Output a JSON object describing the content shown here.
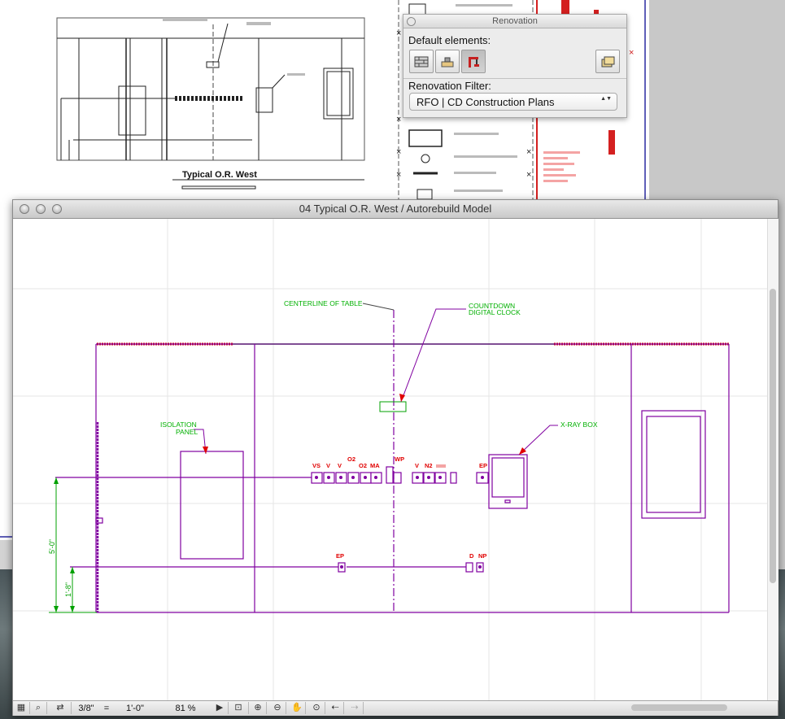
{
  "background_sheet": {
    "view_title": "Typical O.R. West"
  },
  "renovation_palette": {
    "title": "Renovation",
    "default_elements_label": "Default elements:",
    "filter_label": "Renovation Filter:",
    "filter_value": "RFO | CD Construction Plans",
    "element_buttons": [
      {
        "icon": "existing-wall-icon",
        "state": "off"
      },
      {
        "icon": "demolish-icon",
        "state": "off"
      },
      {
        "icon": "new-construction-icon",
        "state": "on"
      }
    ],
    "settings_icon": "renovation-settings-icon"
  },
  "window": {
    "title": "04 Typical O.R. West / Autorebuild Model"
  },
  "drawing": {
    "annotations": {
      "centerline": "CENTERLINE OF TABLE",
      "clock_line1": "COUNTDOWN",
      "clock_line2": "DIGITAL CLOCK",
      "isolation_line1": "ISOLATION",
      "isolation_line2": "PANEL",
      "xray": "X-RAY BOX"
    },
    "outlet_tags": {
      "vs": "VS",
      "v1": "V",
      "v2": "V",
      "o2_top": "O2",
      "o2": "O2",
      "ma": "MA",
      "wp": "WP",
      "v3": "V",
      "n2": "N2",
      "ep_top": "EP",
      "ep_low": "EP",
      "d": "D",
      "np": "NP"
    },
    "dimensions": {
      "upper": "5'-0\"",
      "lower": "1'-8\""
    },
    "colors": {
      "linework": "#8000a0",
      "annotation_text": "#00b000",
      "tags": "#e00000",
      "grid": "#e6e6e6"
    }
  },
  "statusbar": {
    "scale_left": "3/8\"",
    "scale_eq": "=",
    "scale_right": "1'-0\"",
    "zoom": "81 %",
    "icons": [
      "layer-combination-icon",
      "find-icon",
      "model-view-icon",
      "play-icon",
      "zoom-fit-icon",
      "zoom-in-icon",
      "zoom-out-icon",
      "pan-icon",
      "fit-in-window-icon",
      "previous-zoom-icon",
      "next-zoom-icon"
    ]
  }
}
